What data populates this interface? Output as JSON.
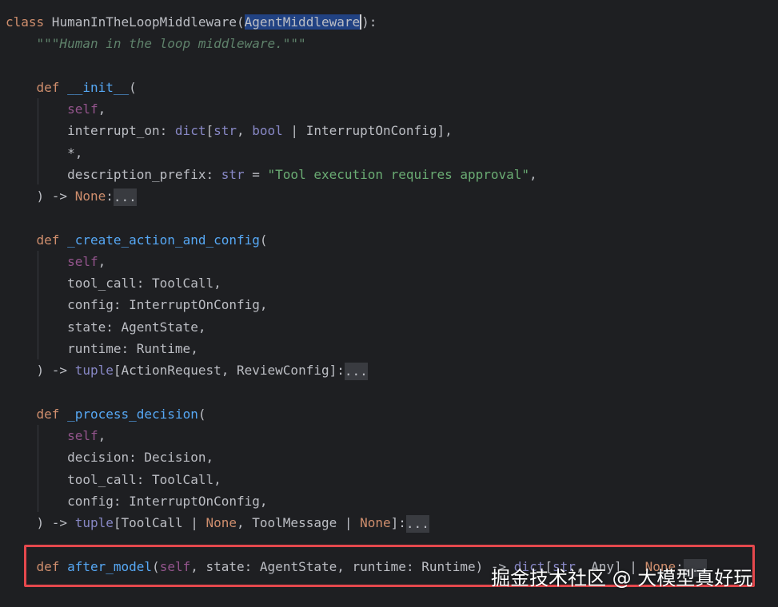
{
  "code": {
    "l1": {
      "kw": "class",
      "name": " HumanInTheLoopMiddleware(",
      "base": "AgentMiddleware",
      "end": "):"
    },
    "l2": {
      "doc": "\"\"\"Human in the loop middleware.\"\"\""
    },
    "l4": {
      "kw": "def",
      "fn": "__init__",
      "open": "("
    },
    "l5": {
      "self": "self",
      "comma": ","
    },
    "l6": {
      "a": "interrupt_on: ",
      "b1": "dict",
      "b2": "[",
      "b3": "str",
      "b4": ", ",
      "b5": "bool",
      "b6": " | InterruptOnConfig],"
    },
    "l7": {
      "t": "*,"
    },
    "l8": {
      "a": "description_prefix: ",
      "b": "str",
      "c": " = ",
      "s": "\"Tool execution requires approval\"",
      "d": ","
    },
    "l9": {
      "a": ") -> ",
      "none": "None",
      "colon": ":",
      "fold": "..."
    },
    "l11": {
      "kw": "def",
      "fn": "_create_action_and_config",
      "open": "("
    },
    "l12": {
      "self": "self",
      "comma": ","
    },
    "l13": {
      "t": "tool_call: ToolCall,"
    },
    "l14": {
      "t": "config: InterruptOnConfig,"
    },
    "l15": {
      "t": "state: AgentState,"
    },
    "l16": {
      "t": "runtime: Runtime,"
    },
    "l17": {
      "a": ") -> ",
      "tuple": "tuple",
      "b": "[ActionRequest, ReviewConfig]:",
      "fold": "..."
    },
    "l19": {
      "kw": "def",
      "fn": "_process_decision",
      "open": "("
    },
    "l20": {
      "self": "self",
      "comma": ","
    },
    "l21": {
      "t": "decision: Decision,"
    },
    "l22": {
      "t": "tool_call: ToolCall,"
    },
    "l23": {
      "t": "config: InterruptOnConfig,"
    },
    "l24": {
      "a": ") -> ",
      "tuple": "tuple",
      "b": "[ToolCall | ",
      "none1": "None",
      "c": ", ToolMessage | ",
      "none2": "None",
      "d": "]:",
      "fold": "..."
    },
    "l26": {
      "kw": "def",
      "fn": "after_model",
      "a": "(",
      "self": "self",
      "b": ", state: AgentState, runtime: Runtime) -> ",
      "dict": "dict",
      "c": "[",
      "str": "str",
      "d": ", Any] | ",
      "none": "None",
      "e": ":",
      "fold": "..."
    }
  },
  "watermark": "掘金技术社区 @ 大模型真好玩",
  "colors": {
    "background": "#1e1f22",
    "keyword": "#cf8e6d",
    "function": "#56a8f5",
    "self": "#94558d",
    "builtin": "#8888c6",
    "string": "#6aab73",
    "docstring": "#5f826b",
    "selection": "#214283",
    "highlight_box": "#e5484d"
  }
}
